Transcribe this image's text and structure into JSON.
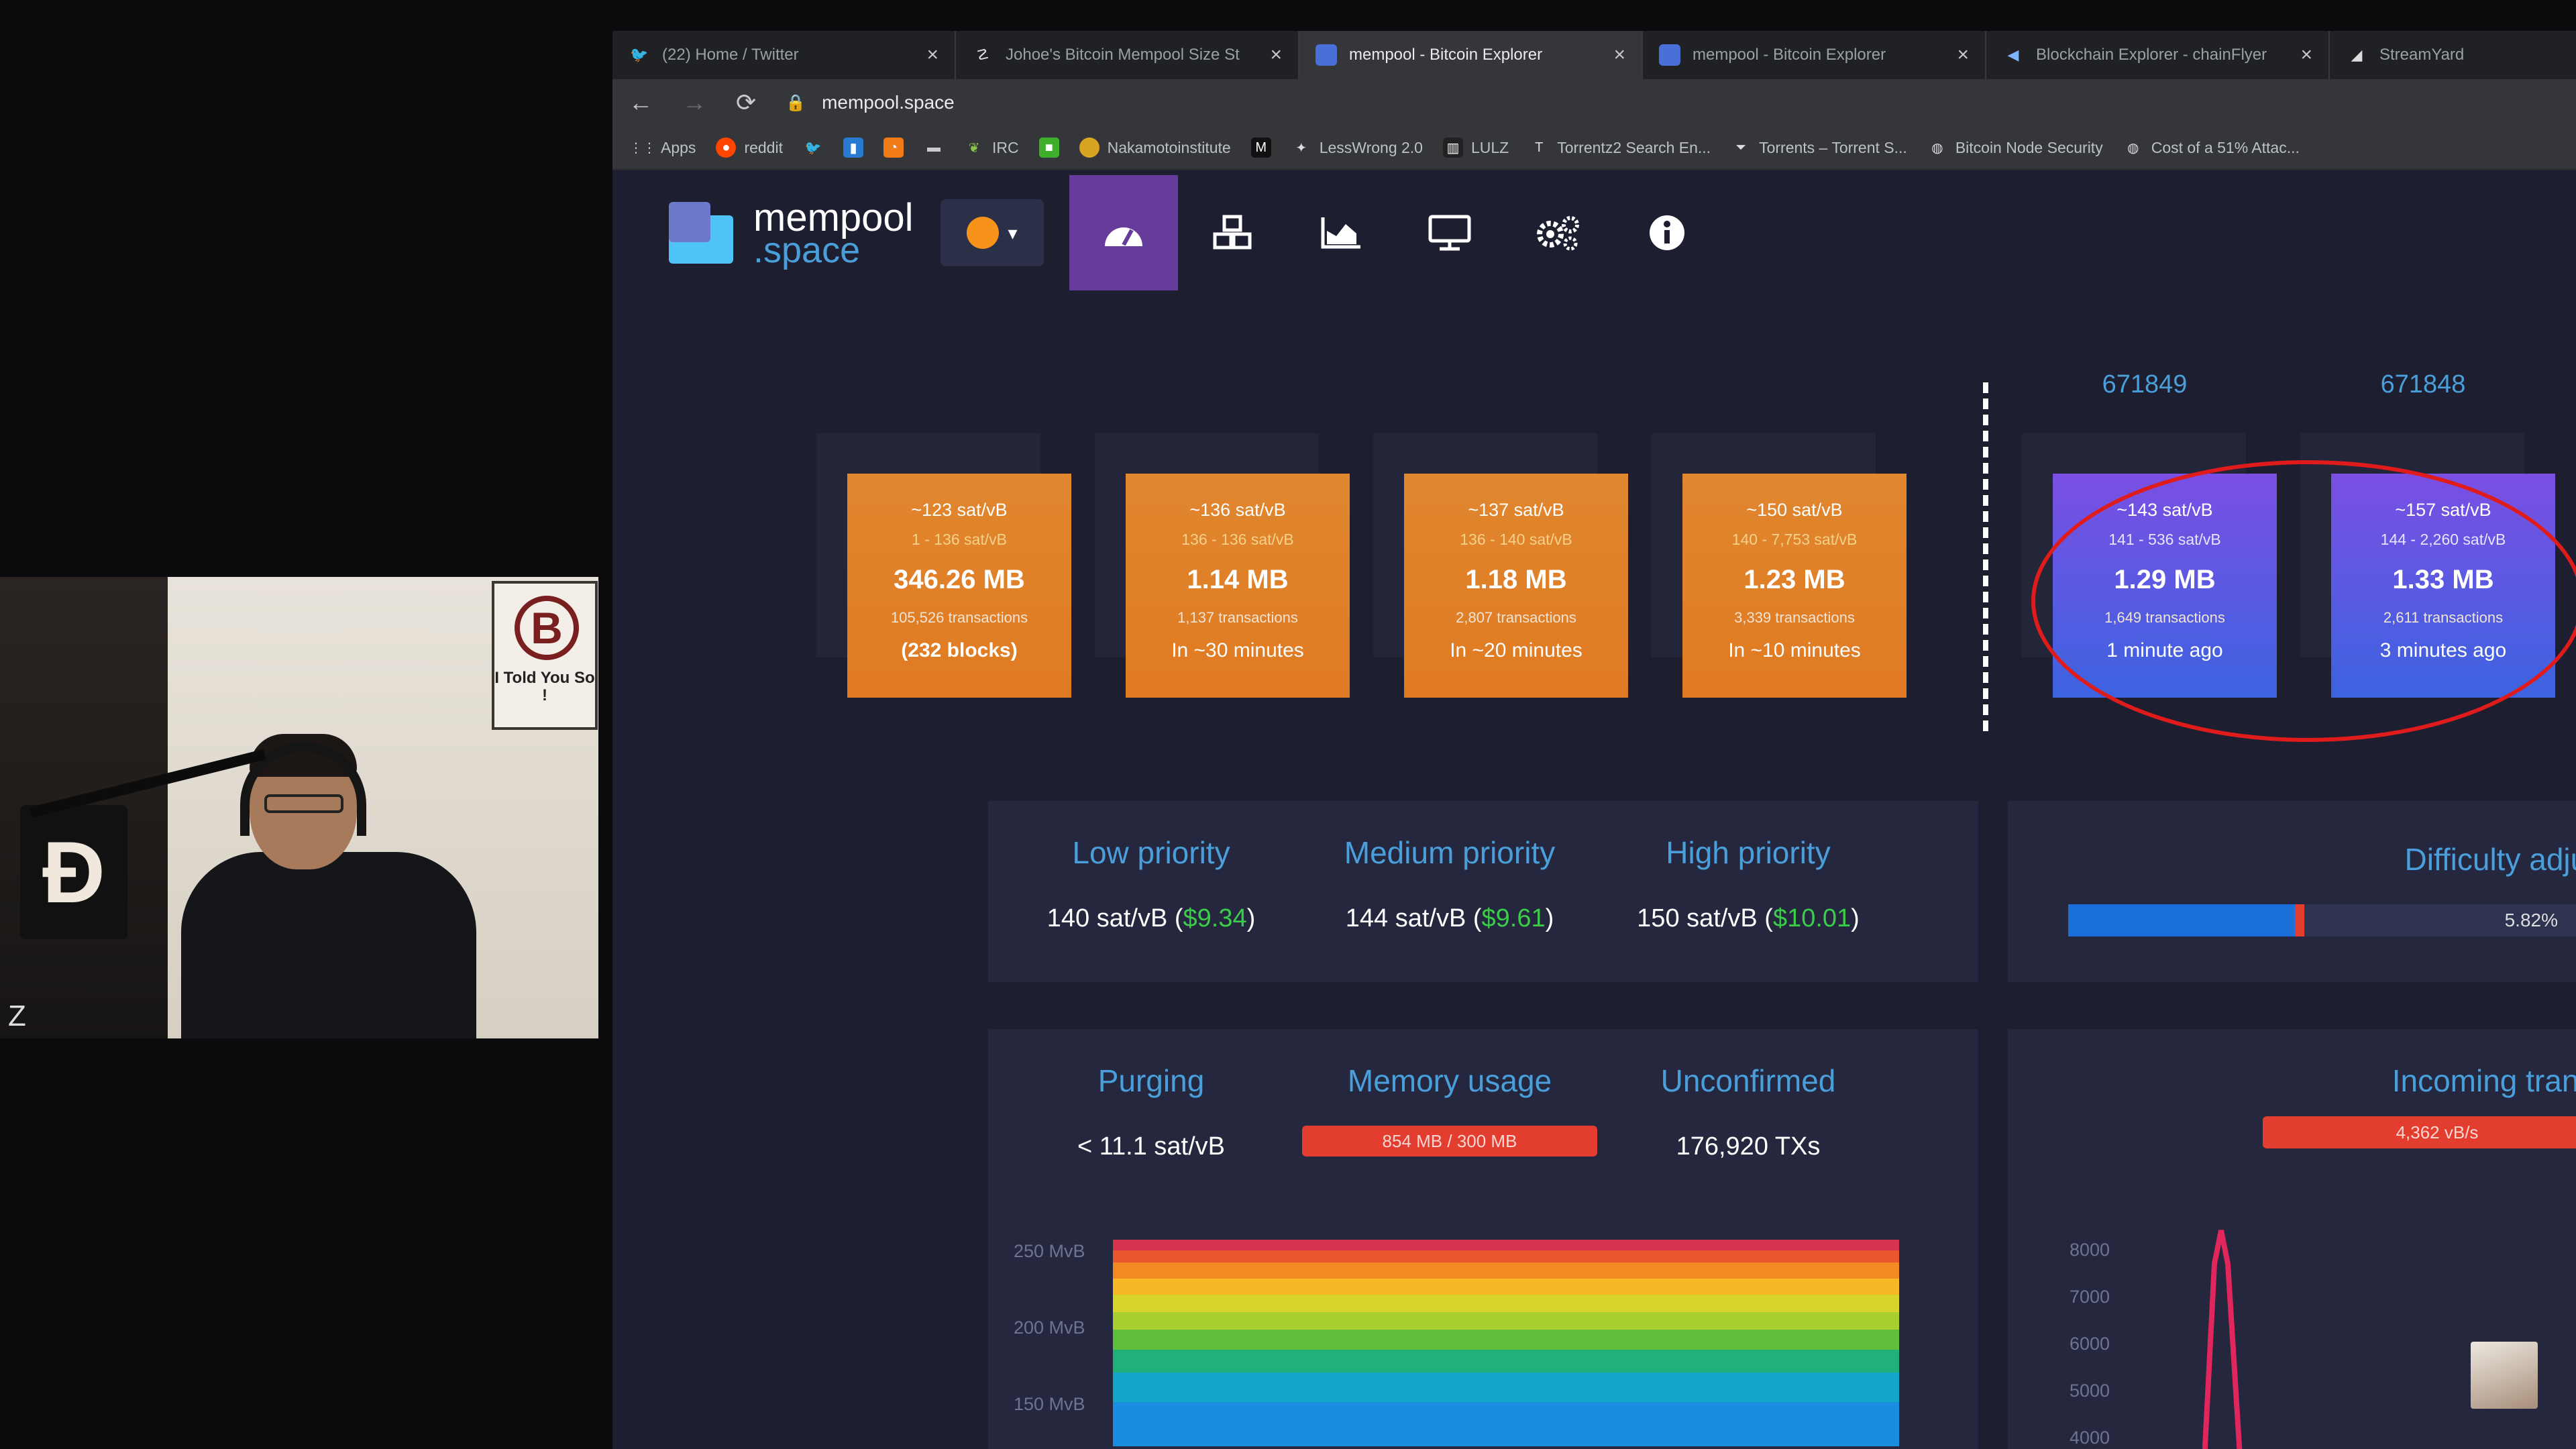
{
  "webcam": {
    "poster_text": "I Told You So !",
    "overlay_letter": "Z"
  },
  "browser": {
    "tabs": [
      {
        "title": "(22) Home / Twitter",
        "icon": "twitter-icon",
        "active": false
      },
      {
        "title": "Johoe's Bitcoin Mempool Size St",
        "icon": "chart-icon",
        "active": false
      },
      {
        "title": "mempool - Bitcoin Explorer",
        "icon": "mempool-icon",
        "active": true
      },
      {
        "title": "mempool - Bitcoin Explorer",
        "icon": "mempool-icon",
        "active": false
      },
      {
        "title": "Blockchain Explorer - chainFlyer",
        "icon": "chainflyer-icon",
        "active": false
      },
      {
        "title": "StreamYard",
        "icon": "streamyard-icon",
        "active": false
      }
    ],
    "url": "mempool.space",
    "bookmarks": [
      "Apps",
      "reddit",
      "",
      "",
      "",
      "",
      "IRC",
      "",
      "Nakamotoinstitute",
      "",
      "LessWrong 2.0",
      "LULZ",
      "Torrentz2 Search En...",
      "Torrents – Torrent S...",
      "Bitcoin Node Security",
      "Cost of a 51% Attac..."
    ]
  },
  "mempool": {
    "brand": {
      "line1": "mempool",
      "line2": ".space"
    },
    "pending_blocks": [
      {
        "fee": "~123 sat/vB",
        "range": "1 - 136 sat/vB",
        "size": "346.26 MB",
        "tx": "105,526 transactions",
        "eta": "(232 blocks)"
      },
      {
        "fee": "~136 sat/vB",
        "range": "136 - 136 sat/vB",
        "size": "1.14 MB",
        "tx": "1,137 transactions",
        "eta": "In ~30 minutes"
      },
      {
        "fee": "~137 sat/vB",
        "range": "136 - 140 sat/vB",
        "size": "1.18 MB",
        "tx": "2,807 transactions",
        "eta": "In ~20 minutes"
      },
      {
        "fee": "~150 sat/vB",
        "range": "140 - 7,753 sat/vB",
        "size": "1.23 MB",
        "tx": "3,339 transactions",
        "eta": "In ~10 minutes"
      }
    ],
    "mined_blocks": [
      {
        "height": "671849",
        "fee": "~143 sat/vB",
        "range": "141 - 536 sat/vB",
        "size": "1.29 MB",
        "tx": "1,649 transactions",
        "ago": "1 minute ago"
      },
      {
        "height": "671848",
        "fee": "~157 sat/vB",
        "range": "144 - 2,260 sat/vB",
        "size": "1.33 MB",
        "tx": "2,611 transactions",
        "ago": "3 minutes ago"
      }
    ],
    "fees": {
      "low": {
        "label": "Low priority",
        "value": "140 sat/vB (",
        "fiat": "$9.34",
        "close": ")"
      },
      "medium": {
        "label": "Medium priority",
        "value": "144 sat/vB (",
        "fiat": "$9.61",
        "close": ")"
      },
      "high": {
        "label": "High priority",
        "value": "150 sat/vB (",
        "fiat": "$10.01",
        "close": ")"
      }
    },
    "difficulty": {
      "label": "Difficulty adjust",
      "pct": "5.82%",
      "progress": 0.5
    },
    "stats": {
      "purging": {
        "label": "Purging",
        "value": "< 11.1 sat/vB"
      },
      "memory": {
        "label": "Memory usage",
        "value": "854 MB / 300 MB"
      },
      "unconfirmed": {
        "label": "Unconfirmed",
        "value": "176,920 TXs"
      }
    },
    "mempool_chart": {
      "ticks": [
        "250 MvB",
        "200 MvB",
        "150 MvB"
      ]
    },
    "incoming": {
      "label": "Incoming transa",
      "rate": "4,362 vB/s",
      "ticks": [
        "8000",
        "7000",
        "6000",
        "5000",
        "4000"
      ]
    },
    "colors": {
      "pending": "#e07a22",
      "mined": "#4a5de0",
      "accent": "#653b9c",
      "label": "#4a9eda",
      "fiat": "#3bcc49",
      "alert": "#e23d2e"
    }
  }
}
